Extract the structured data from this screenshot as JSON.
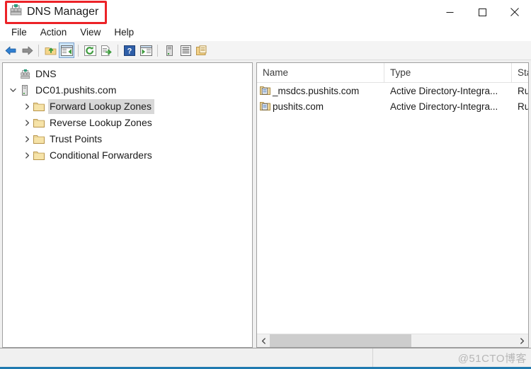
{
  "window": {
    "title": "DNS Manager",
    "title_icon": "dns-server-icon",
    "highlight_color": "#ec2227",
    "controls": [
      {
        "name": "minimize-button",
        "glyph": "minimize-icon",
        "label": "Minimize"
      },
      {
        "name": "maximize-button",
        "glyph": "maximize-icon",
        "label": "Maximize"
      },
      {
        "name": "close-button",
        "glyph": "close-icon",
        "label": "Close"
      }
    ]
  },
  "menubar": {
    "items": [
      {
        "label": "File"
      },
      {
        "label": "Action"
      },
      {
        "label": "View"
      },
      {
        "label": "Help"
      }
    ]
  },
  "toolbar": {
    "buttons": [
      {
        "name": "back-button",
        "icon": "back-arrow-icon",
        "checked": false
      },
      {
        "name": "forward-button",
        "icon": "forward-arrow-icon",
        "checked": false
      },
      {
        "name": "separator-1",
        "icon": "separator",
        "checked": false
      },
      {
        "name": "up-one-level-button",
        "icon": "folder-up-icon",
        "checked": false
      },
      {
        "name": "show-hide-console-tree-button",
        "icon": "console-tree-icon",
        "checked": true
      },
      {
        "name": "separator-2",
        "icon": "separator",
        "checked": false
      },
      {
        "name": "refresh-button",
        "icon": "refresh-icon",
        "checked": false
      },
      {
        "name": "export-list-button",
        "icon": "export-list-icon",
        "checked": false
      },
      {
        "name": "separator-3",
        "icon": "separator",
        "checked": false
      },
      {
        "name": "help-button",
        "icon": "help-question-icon",
        "checked": false
      },
      {
        "name": "show-action-pane-button",
        "icon": "action-pane-icon",
        "checked": false
      },
      {
        "name": "separator-4",
        "icon": "separator",
        "checked": false
      },
      {
        "name": "new-server-button",
        "icon": "server-icon",
        "checked": false
      },
      {
        "name": "properties-button",
        "icon": "properties-list-icon",
        "checked": false
      },
      {
        "name": "copy-button",
        "icon": "copy-clipboard-icon",
        "checked": false
      }
    ]
  },
  "tree": {
    "nodes": [
      {
        "label": "DNS",
        "icon": "dns-server-icon",
        "indent": 0,
        "twisty": "none",
        "selected": false
      },
      {
        "label": "DC01.pushits.com",
        "icon": "server-tower-icon",
        "indent": 1,
        "twisty": "expanded",
        "selected": false
      },
      {
        "label": "Forward Lookup Zones",
        "icon": "folder-icon",
        "indent": 2,
        "twisty": "collapsed",
        "selected": true
      },
      {
        "label": "Reverse Lookup Zones",
        "icon": "folder-icon",
        "indent": 2,
        "twisty": "collapsed",
        "selected": false
      },
      {
        "label": "Trust Points",
        "icon": "folder-icon",
        "indent": 2,
        "twisty": "collapsed",
        "selected": false
      },
      {
        "label": "Conditional Forwarders",
        "icon": "folder-icon",
        "indent": 2,
        "twisty": "collapsed",
        "selected": false
      }
    ]
  },
  "listview": {
    "columns": [
      {
        "label": "Name"
      },
      {
        "label": "Type"
      },
      {
        "label": "Sta"
      }
    ],
    "rows": [
      {
        "icon": "zone-folder-icon",
        "name": "_msdcs.pushits.com",
        "type": "Active Directory-Integra...",
        "status": "Ru"
      },
      {
        "icon": "zone-folder-icon",
        "name": "pushits.com",
        "type": "Active Directory-Integra...",
        "status": "Ru"
      }
    ]
  },
  "scrollbar": {
    "left_arrow": "chevron-left-icon",
    "right_arrow": "chevron-right-icon"
  },
  "statusbar": {
    "left_text": "",
    "watermark": "@51CTO博客"
  }
}
